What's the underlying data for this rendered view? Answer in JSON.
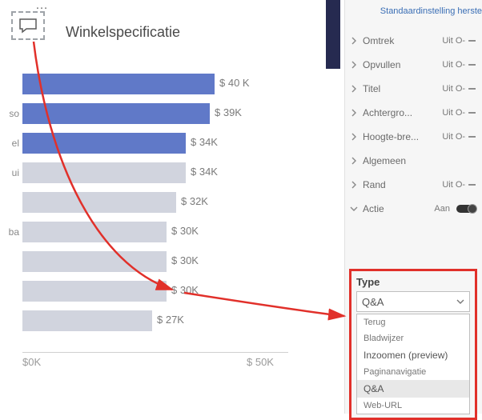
{
  "title": "Winkelspecificatie",
  "reset_link": "Standaardinstelling herste",
  "chart_data": {
    "type": "bar",
    "orientation": "horizontal",
    "title": "Winkelspecificatie",
    "xlabel": "",
    "ylabel": "",
    "xlim": [
      0,
      50
    ],
    "xunit": "K",
    "ticks": [
      "$0K",
      "$ 50K"
    ],
    "bars": [
      {
        "category": "",
        "value": 40,
        "label": "$ 40 K",
        "placeholder": false
      },
      {
        "category": "so",
        "value": 39,
        "label": "$ 39K",
        "placeholder": false
      },
      {
        "category": "el",
        "value": 34,
        "label": "$ 34K",
        "placeholder": false
      },
      {
        "category": "ui",
        "value": 34,
        "label": "$ 34K",
        "placeholder": true
      },
      {
        "category": "",
        "value": 32,
        "label": "$ 32K",
        "placeholder": true
      },
      {
        "category": "ba",
        "value": 30,
        "label": "$ 30K",
        "placeholder": true
      },
      {
        "category": "",
        "value": 30,
        "label": "$ 30K",
        "placeholder": true
      },
      {
        "category": "",
        "value": 30,
        "label": "$ 30K",
        "placeholder": true
      },
      {
        "category": "",
        "value": 27,
        "label": "$ 27K",
        "placeholder": true
      }
    ]
  },
  "props": [
    {
      "name": "Omtrek",
      "value": "Uit O-",
      "chev": "right",
      "dash": true
    },
    {
      "name": "Opvullen",
      "value": "Uit O-",
      "chev": "right",
      "dash": true
    },
    {
      "name": "Titel",
      "value": "Uit O-",
      "chev": "right",
      "dash": true
    },
    {
      "name": "Achtergro...",
      "value": "Uit O-",
      "chev": "right",
      "dash": true
    },
    {
      "name": "Hoogte-bre...",
      "value": "Uit O-",
      "chev": "right",
      "dash": true
    },
    {
      "name": "Algemeen",
      "value": "",
      "chev": "right",
      "dash": false
    },
    {
      "name": "Rand",
      "value": "Uit O-",
      "chev": "right",
      "dash": true
    },
    {
      "name": "Actie",
      "value": "Aan",
      "chev": "down",
      "toggle": true
    }
  ],
  "type_section": {
    "label": "Type",
    "selected": "Q&A",
    "options": [
      {
        "label": "Terug",
        "small": true
      },
      {
        "label": "Bladwijzer",
        "small": true
      },
      {
        "label": "Inzoomen (preview)",
        "small": false
      },
      {
        "label": "Paginanavigatie",
        "small": true
      },
      {
        "label": "Q&A",
        "small": false,
        "selected": true
      },
      {
        "label": "Web-URL",
        "small": true
      }
    ]
  }
}
